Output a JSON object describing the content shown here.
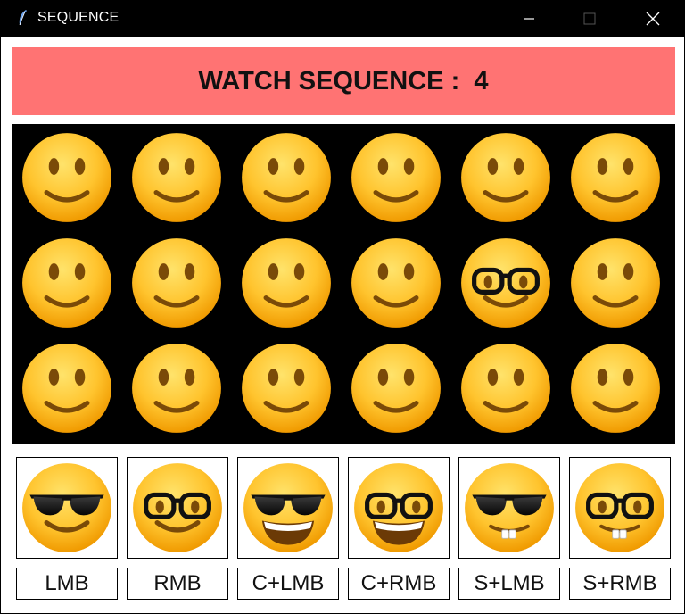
{
  "window": {
    "title": "SEQUENCE",
    "icon": "feather-icon",
    "controls": [
      "minimize-icon",
      "maximize-icon",
      "close-icon"
    ]
  },
  "banner": {
    "label": "WATCH SEQUENCE :",
    "value": "4",
    "text": "WATCH SEQUENCE :  4",
    "background": "#ff7373"
  },
  "board": {
    "rows": 3,
    "cols": 6,
    "background": "#000000",
    "cells": [
      [
        "smile",
        "smile",
        "smile",
        "smile",
        "smile",
        "smile"
      ],
      [
        "smile",
        "smile",
        "smile",
        "smile",
        "nerd-glasses",
        "smile"
      ],
      [
        "smile",
        "smile",
        "smile",
        "smile",
        "smile",
        "smile"
      ]
    ]
  },
  "controls": [
    {
      "face": "sunglasses-smile",
      "label": "LMB"
    },
    {
      "face": "nerd-glasses",
      "label": "RMB"
    },
    {
      "face": "sunglasses-grin",
      "label": "C+LMB"
    },
    {
      "face": "nerd-grin",
      "label": "C+RMB"
    },
    {
      "face": "sunglasses-buck",
      "label": "S+LMB"
    },
    {
      "face": "nerd-buck",
      "label": "S+RMB"
    }
  ],
  "colors": {
    "face": "#ffc83a",
    "face_edge": "#f0a000",
    "feature": "#7a4a08",
    "frame": "#000000"
  }
}
